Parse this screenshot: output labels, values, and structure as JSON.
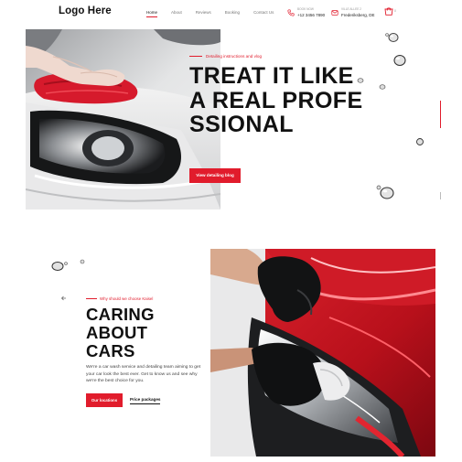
{
  "header": {
    "logo": "Logo Here",
    "nav": [
      "Home",
      "About",
      "Reviews",
      "Booking",
      "Contact Us"
    ],
    "active_nav": "Home",
    "phone_label": "BOOK NOW",
    "phone": "+12 3456 7890",
    "address_label": "VILLE ALLEE 2",
    "address": "Frederiksberg, DE",
    "cart_count": "0",
    "icons": [
      "phone-icon",
      "location-icon",
      "cart-icon"
    ]
  },
  "hero": {
    "eyebrow": "Detailing instructions and vlog",
    "title": "TREAT IT LIKE A REAL PROFESSIONAL",
    "button": "View detailing blog",
    "image": "hand-with-red-cloth-polishing-white-car-headlight"
  },
  "caring": {
    "eyebrow": "Why should we choose Kaisel",
    "title_lines": [
      "CARING",
      "ABOUT",
      "CARS"
    ],
    "text": "We're a car wash service and detailing team aiming to get your car look the best ever. Get to know us and see why we're the best choice for you.",
    "primary_button": "Our locations",
    "secondary_link": "Price packages",
    "image": "gloved-hands-wiping-red-car-headlight"
  },
  "colors": {
    "accent": "#e11c2c",
    "text": "#111111",
    "muted": "#777777",
    "background": "#ffffff"
  }
}
